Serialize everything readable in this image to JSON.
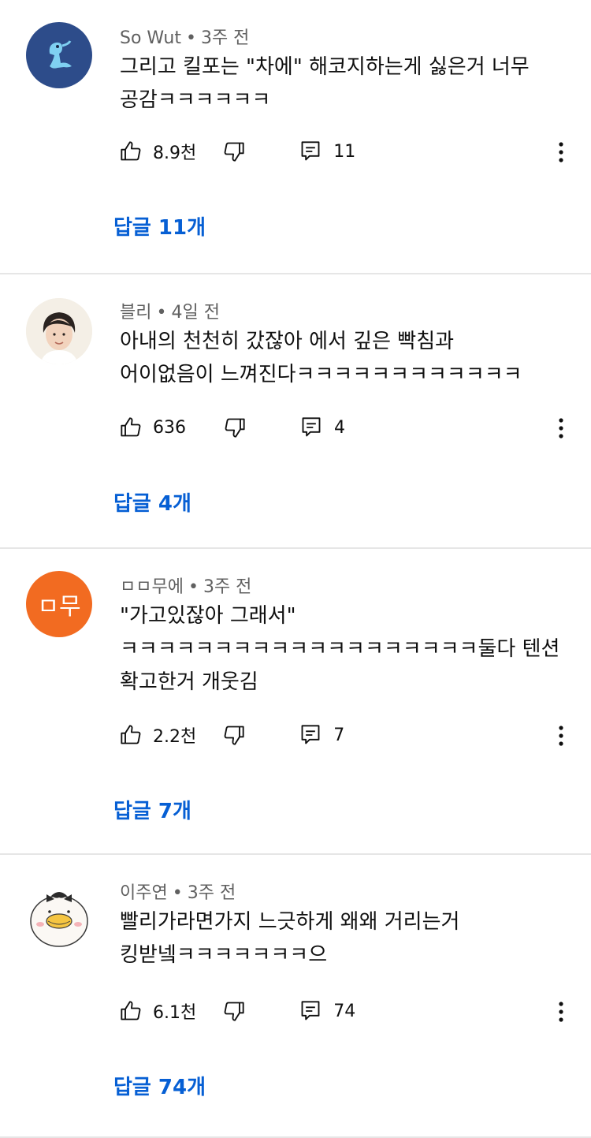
{
  "comments": [
    {
      "author": "So Wut",
      "time": "3주 전",
      "text": "그리고 킬포는 \"차에\" 해코지하는게 싫은거 너무\n공감ㅋㅋㅋㅋㅋㅋ",
      "likes": "8.9천",
      "reply_count": "11",
      "replies_label": "답글 11개",
      "avatar_icon": "blue-creature-avatar"
    },
    {
      "author": "블리",
      "time": "4일 전",
      "text": "아내의 천천히 갔잖아 에서 깊은 빡침과\n어이없음이 느껴진다ㅋㅋㅋㅋㅋㅋㅋㅋㅋㅋㅋㅋ",
      "likes": "636",
      "reply_count": "4",
      "replies_label": "답글 4개",
      "avatar_icon": "person-photo-avatar"
    },
    {
      "author": "ㅁㅁ무에",
      "time": "3주 전",
      "text": "\"가고있잖아 그래서\"\nㅋㅋㅋㅋㅋㅋㅋㅋㅋㅋㅋㅋㅋㅋㅋㅋㅋㅋㅋ둘다 텐션\n확고한거 개웃김",
      "likes": "2.2천",
      "reply_count": "7",
      "replies_label": "답글 7개",
      "avatar_text": "ㅁ무",
      "avatar_icon": "orange-initials-avatar"
    },
    {
      "author": "이주연",
      "time": "3주 전",
      "text": "빨리가라면가지 느긋하게 왜왜 거리는거\n킹받넼ㅋㅋㅋㅋㅋㅋㅋ으",
      "likes": "6.1천",
      "reply_count": "74",
      "replies_label": "답글 74개",
      "avatar_icon": "duck-cartoon-avatar"
    }
  ],
  "icons": {
    "like": "thumbs-up-icon",
    "dislike": "thumbs-down-icon",
    "reply": "comment-icon",
    "more": "more-vertical-icon"
  },
  "colors": {
    "link": "#065fd4",
    "meta": "#606060",
    "avatar_orange": "#f26b21",
    "avatar_blue": "#2d4c8a"
  }
}
